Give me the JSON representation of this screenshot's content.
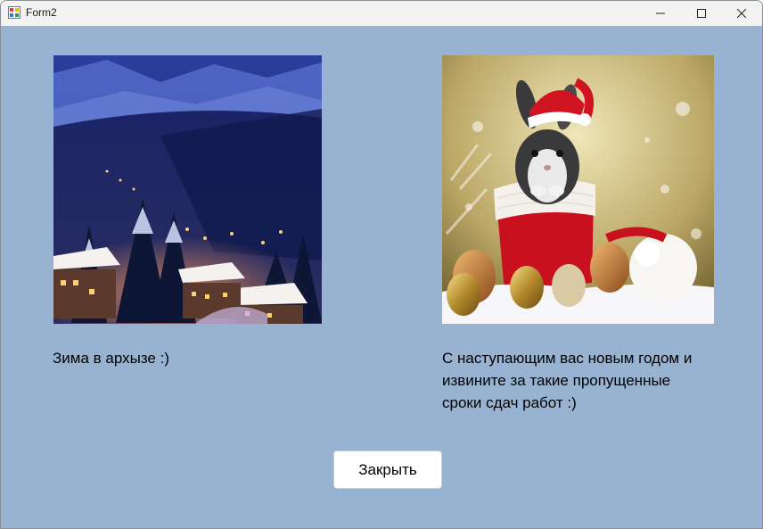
{
  "window": {
    "title": "Form2",
    "controls": [
      "minimize-icon",
      "maximize-icon",
      "close-icon"
    ]
  },
  "form": {
    "left_image": {
      "description_icon": "winter-village-photo"
    },
    "right_image": {
      "description_icon": "christmas-bunny-photo"
    },
    "left_caption": "Зима в архызе :)",
    "right_caption": "С наступающим вас новым годом и\nизвините за такие пропущенные\nсроки сдач работ :)",
    "close_button_label": "Закрыть"
  },
  "colors": {
    "form_background": "#98b3d1",
    "titlebar": "#f3f3f3",
    "button": "#ffffff"
  }
}
